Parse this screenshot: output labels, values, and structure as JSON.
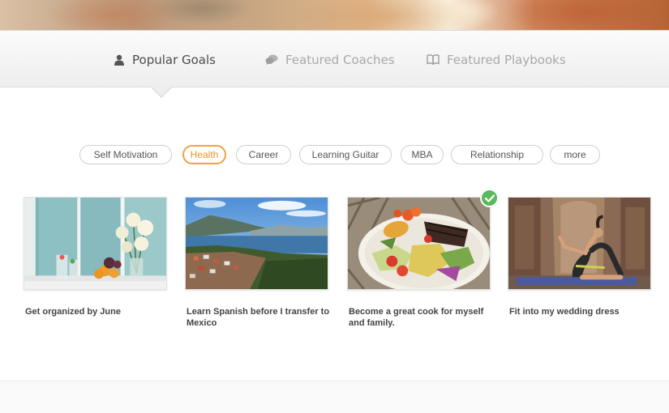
{
  "tabs": [
    {
      "label": "Popular Goals",
      "icon": "person-icon",
      "active": true
    },
    {
      "label": "Featured Coaches",
      "icon": "chat-bubbles-icon",
      "active": false
    },
    {
      "label": "Featured Playbooks",
      "icon": "book-icon",
      "active": false
    }
  ],
  "categories": [
    {
      "label": "Self Motivation",
      "active": false
    },
    {
      "label": "Health",
      "active": true
    },
    {
      "label": "Career",
      "active": false
    },
    {
      "label": "Learning Guitar",
      "active": false
    },
    {
      "label": "MBA",
      "active": false
    },
    {
      "label": "Relationship",
      "active": false
    },
    {
      "label": "more",
      "active": false
    }
  ],
  "goals": [
    {
      "title": "Get organized by June",
      "image": "kitchen-window-flowers-fruit-photo",
      "selected": false
    },
    {
      "title": "Learn Spanish before I transfer to Mexico",
      "image": "lake-town-mountains-photo",
      "selected": false
    },
    {
      "title": "Become a great cook for myself and family.",
      "image": "grilled-food-plate-photo",
      "selected": true
    },
    {
      "title": "Fit into my wedding dress",
      "image": "yoga-pose-photo",
      "selected": false
    }
  ],
  "colors": {
    "accent": "#f2a23a",
    "check": "#5cb85c",
    "tab_active": "#4d4d4d",
    "tab_inactive": "#a9a9a9"
  }
}
